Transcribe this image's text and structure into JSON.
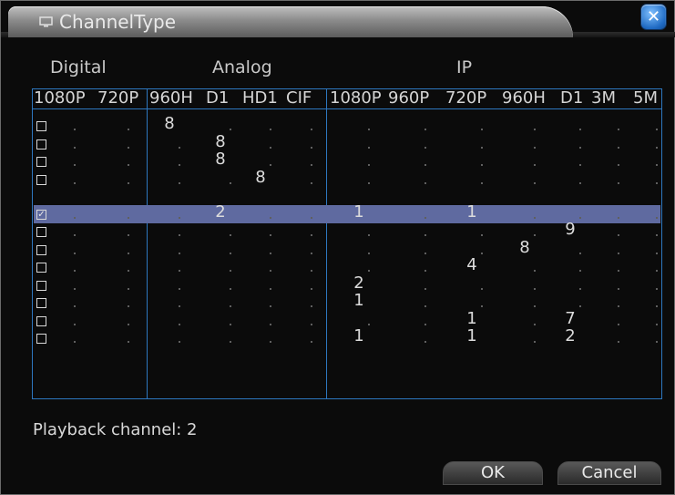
{
  "window": {
    "title": "ChannelType",
    "close_icon": "close-icon",
    "accent_color": "#2d77bf"
  },
  "groups": {
    "digital": "Digital",
    "analog": "Analog",
    "ip": "IP"
  },
  "columns": [
    "1080P",
    "720P",
    "960H",
    "D1",
    "HD1",
    "CIF",
    "1080P",
    "960P",
    "720P",
    "960H",
    "D1",
    "3M",
    "5M"
  ],
  "rows": [
    {
      "checked": false,
      "values": [
        "",
        "",
        "8",
        "",
        "",
        "",
        "",
        "",
        "",
        "",
        "",
        "",
        ""
      ]
    },
    {
      "checked": false,
      "values": [
        "",
        "",
        "",
        "8",
        "",
        "",
        "",
        "",
        "",
        "",
        "",
        "",
        ""
      ]
    },
    {
      "checked": false,
      "values": [
        "",
        "",
        "",
        "8",
        "",
        "",
        "",
        "",
        "",
        "",
        "",
        "",
        ""
      ]
    },
    {
      "checked": false,
      "values": [
        "",
        "",
        "",
        "",
        "8",
        "",
        "",
        "",
        "",
        "",
        "",
        "",
        ""
      ]
    },
    {
      "checked": true,
      "values": [
        "",
        "",
        "",
        "2",
        "",
        "",
        "1",
        "",
        "1",
        "",
        "",
        "",
        ""
      ]
    },
    {
      "checked": false,
      "values": [
        "",
        "",
        "",
        "",
        "",
        "",
        "",
        "",
        "",
        "",
        "9",
        "",
        ""
      ]
    },
    {
      "checked": false,
      "values": [
        "",
        "",
        "",
        "",
        "",
        "",
        "",
        "",
        "",
        "8",
        "",
        "",
        ""
      ]
    },
    {
      "checked": false,
      "values": [
        "",
        "",
        "",
        "",
        "",
        "",
        "",
        "",
        "4",
        "",
        "",
        "",
        ""
      ]
    },
    {
      "checked": false,
      "values": [
        "",
        "",
        "",
        "",
        "",
        "",
        "2",
        "",
        "",
        "",
        "",
        "",
        ""
      ]
    },
    {
      "checked": false,
      "values": [
        "",
        "",
        "",
        "",
        "",
        "",
        "1",
        "",
        "",
        "",
        "",
        "",
        ""
      ]
    },
    {
      "checked": false,
      "values": [
        "",
        "",
        "",
        "",
        "",
        "",
        "",
        "",
        "1",
        "",
        "7",
        "",
        ""
      ]
    },
    {
      "checked": false,
      "values": [
        "",
        "",
        "",
        "",
        "",
        "",
        "1",
        "",
        "1",
        "",
        "2",
        "",
        ""
      ]
    }
  ],
  "footer": {
    "playback_label": "Playback channel: 2",
    "ok_label": "OK",
    "cancel_label": "Cancel"
  }
}
